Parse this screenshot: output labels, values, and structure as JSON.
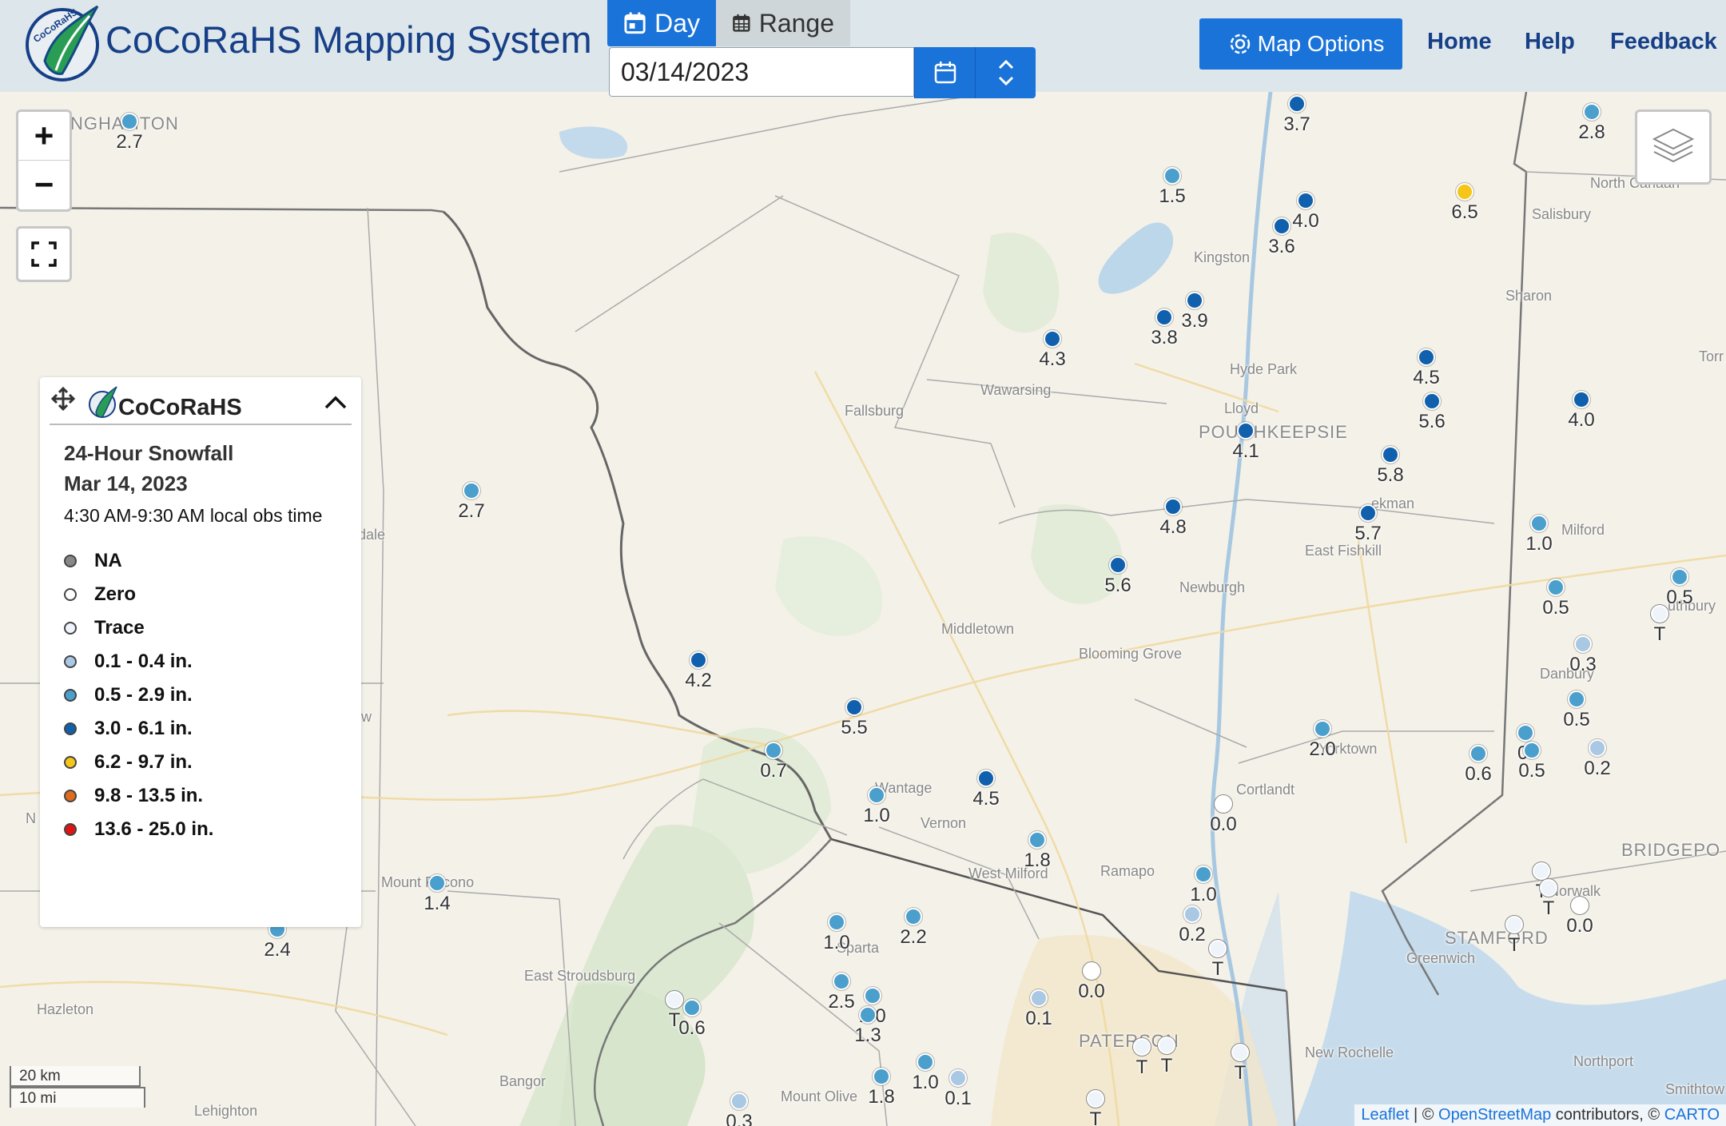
{
  "app": {
    "title": "CoCoRaHS Mapping System",
    "logo_text": "CoCoRaHS"
  },
  "mode_tabs": {
    "day": "Day",
    "range": "Range"
  },
  "date_input": {
    "value": "03/14/2023"
  },
  "map_options": {
    "label": "Map Options"
  },
  "nav": {
    "home": "Home",
    "help": "Help",
    "feedback": "Feedback"
  },
  "zoom": {
    "in": "+",
    "out": "−"
  },
  "legend": {
    "brand": "CoCoRaHS",
    "title": "24-Hour Snowfall",
    "date": "Mar 14, 2023",
    "obs_time": "4:30 AM-9:30 AM local obs time",
    "items": [
      {
        "label": "NA",
        "color": "#888888"
      },
      {
        "label": "Zero",
        "color": "#ffffff"
      },
      {
        "label": "Trace",
        "color": "#eef4fa"
      },
      {
        "label": "0.1 - 0.4 in.",
        "color": "#a9c8e4"
      },
      {
        "label": "0.5 - 2.9 in.",
        "color": "#4b9fcc"
      },
      {
        "label": "3.0 - 6.1 in.",
        "color": "#1060ad"
      },
      {
        "label": "6.2 - 9.7 in.",
        "color": "#f5c518"
      },
      {
        "label": "9.8 - 13.5 in.",
        "color": "#e06b1a"
      },
      {
        "label": "13.6 - 25.0 in.",
        "color": "#e01414"
      }
    ]
  },
  "places": [
    {
      "name": "NGHAMTON",
      "big": true
    },
    {
      "name": "North Canaan"
    },
    {
      "name": "Salisbury"
    },
    {
      "name": "Kingston"
    },
    {
      "name": "Sharon"
    },
    {
      "name": "Torr"
    },
    {
      "name": "Hyde Park"
    },
    {
      "name": "Wawarsing"
    },
    {
      "name": "Fallsburg"
    },
    {
      "name": "Lloyd"
    },
    {
      "name": "POUGHKEEPSIE",
      "big": true
    },
    {
      "name": "ekman"
    },
    {
      "name": "Milford"
    },
    {
      "name": "East Fishkill"
    },
    {
      "name": "Newburgh"
    },
    {
      "name": "uthbury"
    },
    {
      "name": "Middletown"
    },
    {
      "name": "Blooming Grove"
    },
    {
      "name": "Danbury"
    },
    {
      "name": "dale"
    },
    {
      "name": "w"
    },
    {
      "name": "N"
    },
    {
      "name": "Yorktown"
    },
    {
      "name": "Cortlandt"
    },
    {
      "name": "Wantage"
    },
    {
      "name": "Vernon"
    },
    {
      "name": "BRIDGEPO",
      "big": true
    },
    {
      "name": "West Milford"
    },
    {
      "name": "Ramapo"
    },
    {
      "name": "Mount Pocono"
    },
    {
      "name": "Norwalk"
    },
    {
      "name": "Sparta"
    },
    {
      "name": "STAMFORD",
      "big": true
    },
    {
      "name": "Greenwich"
    },
    {
      "name": "East Stroudsburg"
    },
    {
      "name": "Hazleton"
    },
    {
      "name": "PATERSON",
      "big": true
    },
    {
      "name": "New Rochelle"
    },
    {
      "name": "Northport"
    },
    {
      "name": "Bangor"
    },
    {
      "name": "Mount Olive"
    },
    {
      "name": "Smithtow"
    },
    {
      "name": "Lehighton"
    }
  ],
  "stations": [
    {
      "value": "3.7",
      "color": "#1060ad"
    },
    {
      "value": "2.8",
      "color": "#4b9fcc"
    },
    {
      "value": "2.7",
      "color": "#4b9fcc"
    },
    {
      "value": "1.5",
      "color": "#4b9fcc"
    },
    {
      "value": "4.0",
      "color": "#1060ad"
    },
    {
      "value": "3.6",
      "color": "#1060ad"
    },
    {
      "value": "6.5",
      "color": "#f5c518"
    },
    {
      "value": "3.9",
      "color": "#1060ad"
    },
    {
      "value": "3.8",
      "color": "#1060ad"
    },
    {
      "value": "4.3",
      "color": "#1060ad"
    },
    {
      "value": "4.5",
      "color": "#1060ad"
    },
    {
      "value": "5.6",
      "color": "#1060ad"
    },
    {
      "value": "4.0",
      "color": "#1060ad"
    },
    {
      "value": "4.1",
      "color": "#1060ad"
    },
    {
      "value": "5.8",
      "color": "#1060ad"
    },
    {
      "value": "2.7",
      "color": "#4b9fcc"
    },
    {
      "value": "4.8",
      "color": "#1060ad"
    },
    {
      "value": "5.7",
      "color": "#1060ad"
    },
    {
      "value": "1.0",
      "color": "#4b9fcc"
    },
    {
      "value": "5.6",
      "color": "#1060ad"
    },
    {
      "value": "0.5",
      "color": "#4b9fcc"
    },
    {
      "value": "0.5",
      "color": "#4b9fcc"
    },
    {
      "value": "T",
      "color": "#eef4fa"
    },
    {
      "value": "0.3",
      "color": "#a9c8e4"
    },
    {
      "value": "4.2",
      "color": "#1060ad"
    },
    {
      "value": "0.5",
      "color": "#4b9fcc"
    },
    {
      "value": "5.5",
      "color": "#1060ad"
    },
    {
      "value": "2.0",
      "color": "#4b9fcc"
    },
    {
      "value": "0.",
      "color": "#4b9fcc"
    },
    {
      "value": "0.7",
      "color": "#4b9fcc"
    },
    {
      "value": "0.6",
      "color": "#4b9fcc"
    },
    {
      "value": "0.5",
      "color": "#4b9fcc"
    },
    {
      "value": "0.2",
      "color": "#a9c8e4"
    },
    {
      "value": "4.5",
      "color": "#1060ad"
    },
    {
      "value": "1.0",
      "color": "#4b9fcc"
    },
    {
      "value": "0.0",
      "color": "#ffffff"
    },
    {
      "value": "1.8",
      "color": "#4b9fcc"
    },
    {
      "value": "1.4",
      "color": "#4b9fcc"
    },
    {
      "value": "1.0",
      "color": "#4b9fcc"
    },
    {
      "value": "T",
      "color": "#eef4fa"
    },
    {
      "value": "T",
      "color": "#eef4fa"
    },
    {
      "value": "0.0",
      "color": "#ffffff"
    },
    {
      "value": "0.2",
      "color": "#a9c8e4"
    },
    {
      "value": "2.4",
      "color": "#4b9fcc"
    },
    {
      "value": "1.0",
      "color": "#4b9fcc"
    },
    {
      "value": "2.2",
      "color": "#4b9fcc"
    },
    {
      "value": "T",
      "color": "#eef4fa"
    },
    {
      "value": "T",
      "color": "#eef4fa"
    },
    {
      "value": "0.0",
      "color": "#ffffff"
    },
    {
      "value": "2.5",
      "color": "#4b9fcc"
    },
    {
      "value": "2.0",
      "color": "#4b9fcc"
    },
    {
      "value": "1.3",
      "color": "#4b9fcc"
    },
    {
      "value": "0.1",
      "color": "#a9c8e4"
    },
    {
      "value": "T",
      "color": "#eef4fa"
    },
    {
      "value": "0.6",
      "color": "#4b9fcc"
    },
    {
      "value": "T",
      "color": "#eef4fa"
    },
    {
      "value": "T",
      "color": "#eef4fa"
    },
    {
      "value": "T",
      "color": "#eef4fa"
    },
    {
      "value": "1.8",
      "color": "#4b9fcc"
    },
    {
      "value": "1.0",
      "color": "#4b9fcc"
    },
    {
      "value": "0.1",
      "color": "#a9c8e4"
    },
    {
      "value": "T",
      "color": "#eef4fa"
    },
    {
      "value": "0.3",
      "color": "#a9c8e4"
    }
  ],
  "scale": {
    "km": "20 km",
    "mi": "10 mi"
  },
  "attribution": {
    "leaflet": "Leaflet",
    "sep1": " | © ",
    "osm": "OpenStreetMap",
    "mid": " contributors, © ",
    "carto": "CARTO"
  }
}
